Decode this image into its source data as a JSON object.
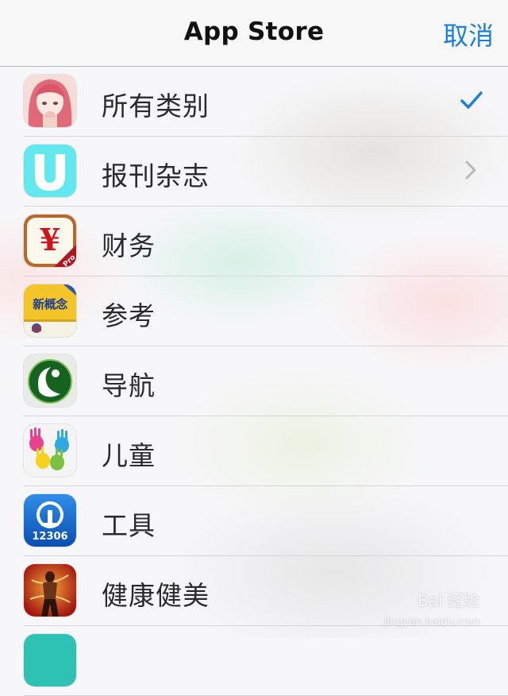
{
  "navbar": {
    "title": "App Store",
    "cancel_label": "取消"
  },
  "categories": [
    {
      "label": "所有类别",
      "icon": "anime-girl-icon",
      "accessory": "checkmark"
    },
    {
      "label": "报刊杂志",
      "icon": "u-newsstand-icon",
      "accessory": "chevron-right"
    },
    {
      "label": "财务",
      "icon": "yen-pro-icon"
    },
    {
      "label": "参考",
      "icon": "new-concept-book-icon",
      "icon_text": "新概念"
    },
    {
      "label": "导航",
      "icon": "green-globe-icon"
    },
    {
      "label": "儿童",
      "icon": "colorful-hands-icon"
    },
    {
      "label": "工具",
      "icon": "railway-12306-icon",
      "icon_text": "12306"
    },
    {
      "label": "健康健美",
      "icon": "fitness-figure-icon"
    }
  ],
  "watermark": {
    "text": "Bai 经验",
    "sub": "jingyan.baidu.com"
  },
  "colors": {
    "accent": "#1a7fe0",
    "separator": "#d6d6da"
  }
}
